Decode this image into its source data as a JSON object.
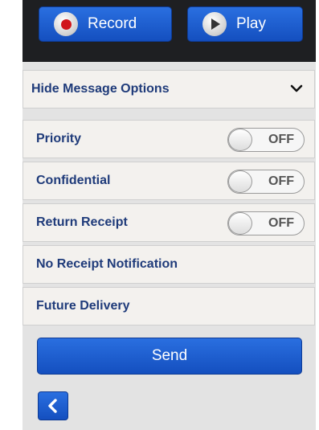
{
  "media": {
    "record_label": "Record",
    "play_label": "Play"
  },
  "options": {
    "header_label": "Hide Message Options",
    "rows": [
      {
        "label": "Priority",
        "toggle": "OFF"
      },
      {
        "label": "Confidential",
        "toggle": "OFF"
      },
      {
        "label": "Return Receipt",
        "toggle": "OFF"
      },
      {
        "label": "No Receipt Notification"
      },
      {
        "label": "Future Delivery"
      }
    ]
  },
  "actions": {
    "send_label": "Send"
  },
  "icons": {
    "record": "record-icon",
    "play": "play-icon",
    "chevron": "chevron-down-icon",
    "back": "back-arrow-icon"
  },
  "colors": {
    "accent": "#1a56cc",
    "label_text": "#1f3b7a",
    "record_red": "#d0151b"
  }
}
